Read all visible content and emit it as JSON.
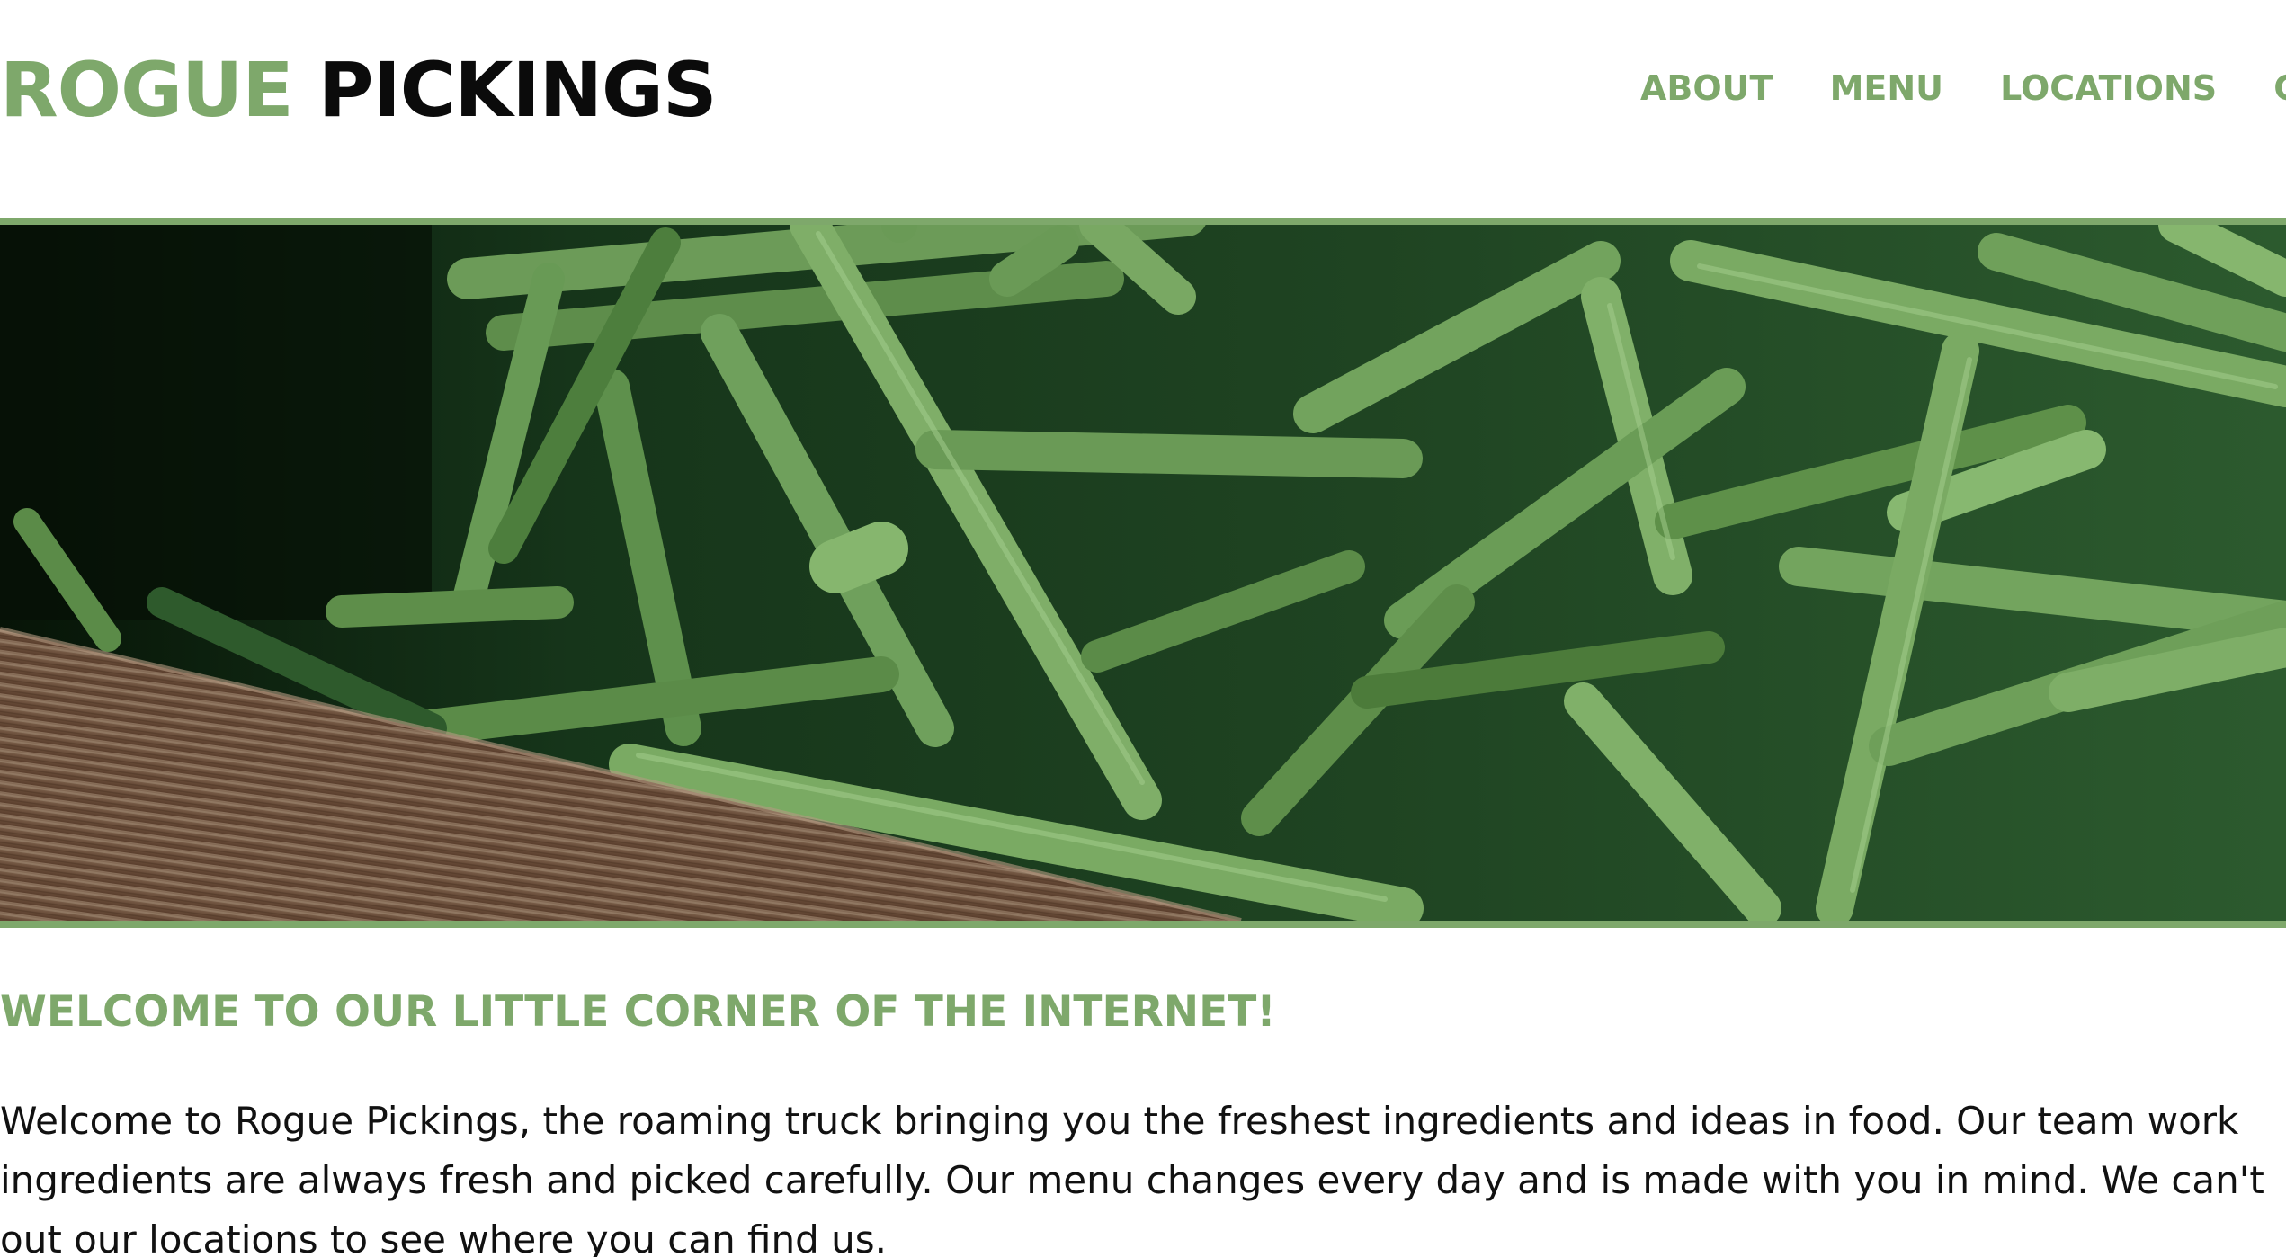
{
  "brand": {
    "part1": "ROGUE",
    "part2": "PICKINGS",
    "accent_color": "#7ea86b",
    "dark_color": "#0b0b0b"
  },
  "nav": {
    "items": [
      {
        "label": "ABOUT"
      },
      {
        "label": "MENU"
      },
      {
        "label": "LOCATIONS"
      },
      {
        "label": "GA"
      }
    ]
  },
  "hero": {
    "image": "green-beans-photo",
    "border_color": "#7ea86b"
  },
  "main": {
    "heading": "WELCOME TO OUR LITTLE CORNER OF THE INTERNET!",
    "paragraph_lines": [
      "Welcome to Rogue Pickings, the roaming truck bringing you the freshest ingredients and ideas in food. Our team work",
      "ingredients are always fresh and picked carefully. Our menu changes every day and is made with you in mind. We can't",
      "out our locations to see where you can find us."
    ]
  }
}
